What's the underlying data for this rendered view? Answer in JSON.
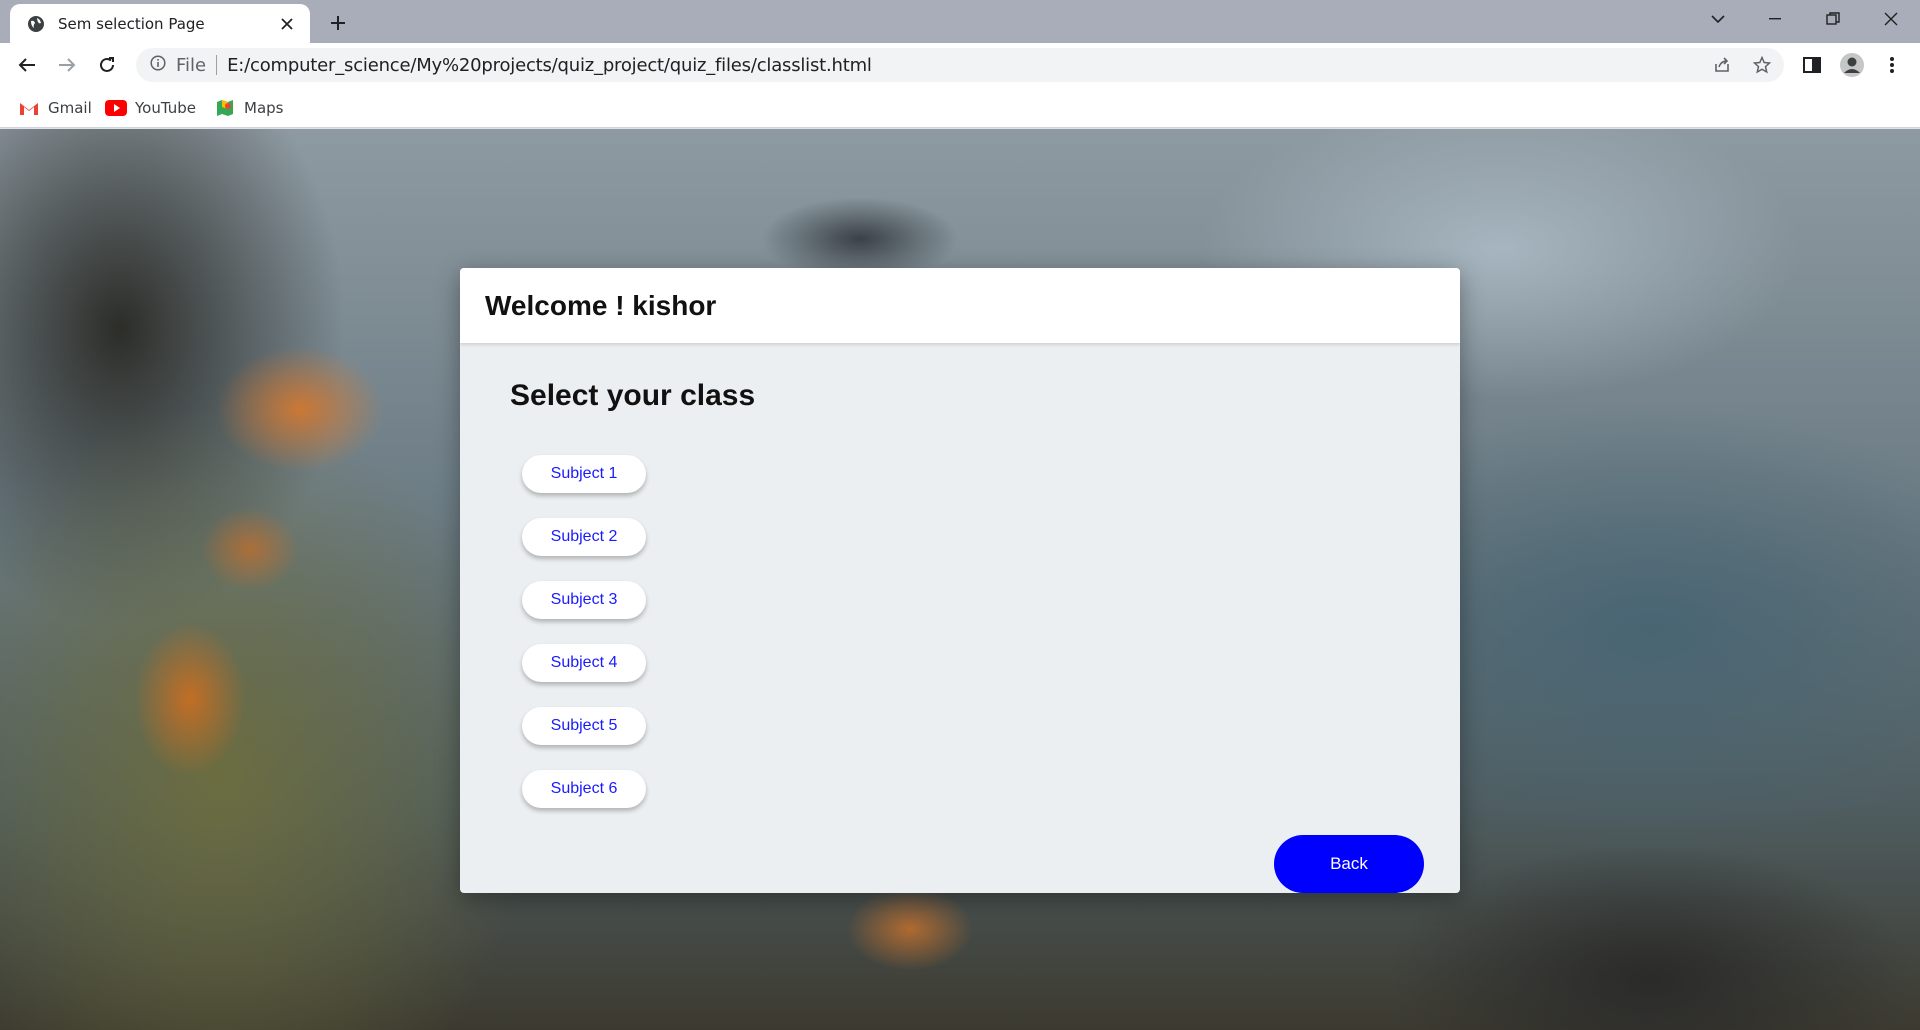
{
  "browser": {
    "tab_title": "Sem selection Page",
    "scheme_label": "File",
    "url": "E:/computer_science/My%20projects/quiz_project/quiz_files/classlist.html",
    "bookmarks": [
      {
        "label": "Gmail",
        "icon": "gmail-icon"
      },
      {
        "label": "YouTube",
        "icon": "youtube-icon"
      },
      {
        "label": "Maps",
        "icon": "maps-icon"
      }
    ]
  },
  "page": {
    "welcome": "Welcome ! kishor",
    "heading": "Select your class",
    "subjects": [
      "Subject 1",
      "Subject 2",
      "Subject 3",
      "Subject 4",
      "Subject 5",
      "Subject 6"
    ],
    "back_label": "Back",
    "accent_color": "#0000ff"
  }
}
